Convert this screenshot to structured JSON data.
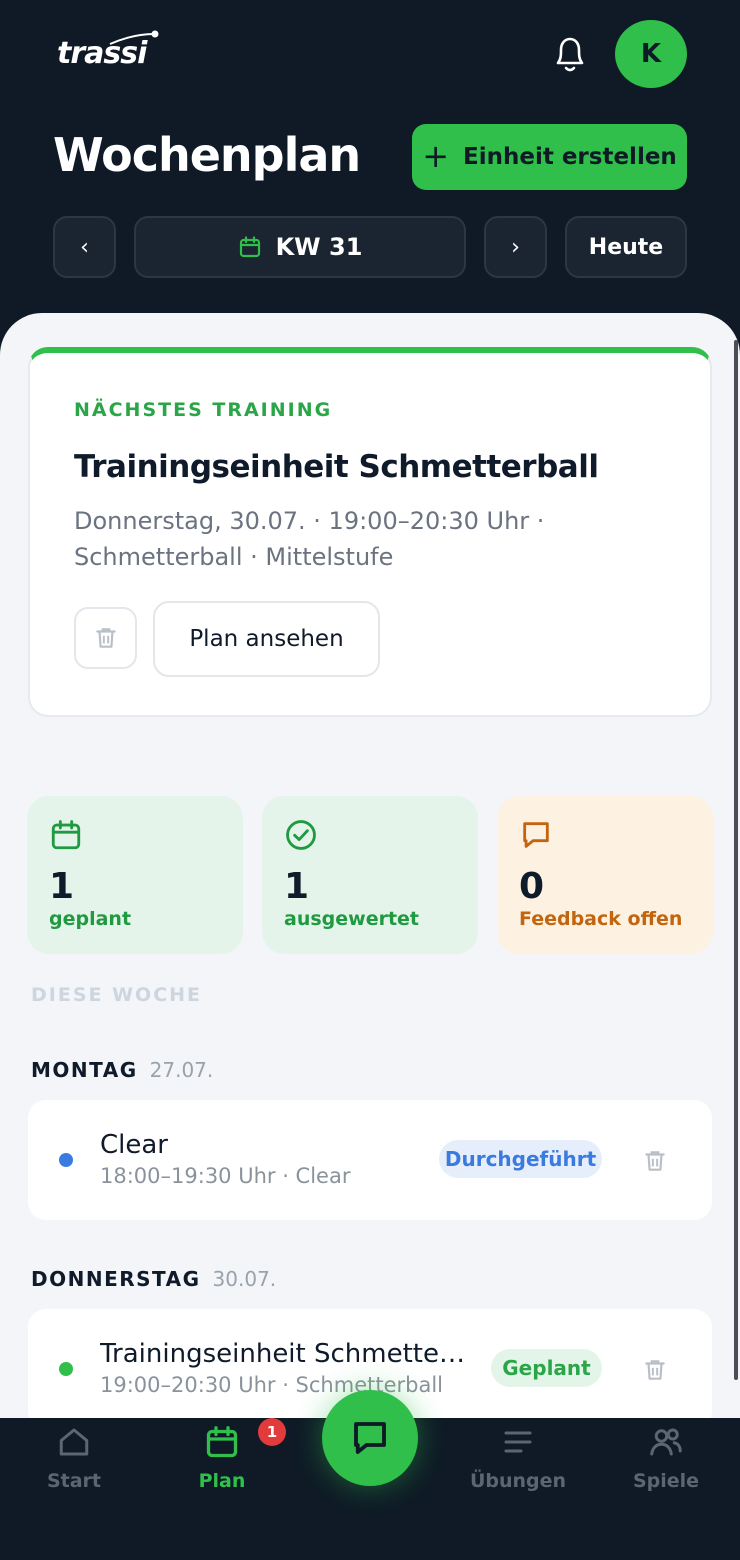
{
  "header": {
    "logo": "trassi",
    "avatar_initial": "K",
    "title": "Wochenplan",
    "create_button": "Einheit erstellen"
  },
  "week_nav": {
    "prev": "‹",
    "week_label": "KW 31",
    "next": "›",
    "today": "Heute"
  },
  "next_training": {
    "label": "NÄCHSTES TRAINING",
    "title": "Trainingseinheit Schmetterball",
    "meta": "Donnerstag, 30.07. · 19:00–20:30 Uhr · Schmetterball · Mittelstufe",
    "view_button": "Plan ansehen"
  },
  "stats": [
    {
      "value": "1",
      "label": "geplant",
      "icon": "calendar-icon"
    },
    {
      "value": "1",
      "label": "ausgewertet",
      "icon": "check-circle-icon"
    },
    {
      "value": "0",
      "label": "Feedback offen",
      "icon": "message-icon"
    }
  ],
  "week_section_label": "DIESE WOCHE",
  "days": [
    {
      "day": "MONTAG",
      "date": "27.07.",
      "events": [
        {
          "title": "Clear",
          "meta": "18:00–19:30 Uhr · Clear",
          "status": "Durchgeführt",
          "dot_color": "#3a7be0"
        }
      ]
    },
    {
      "day": "DONNERSTAG",
      "date": "30.07.",
      "events": [
        {
          "title": "Trainingseinheit Schmetterball",
          "meta": "19:00–20:30 Uhr · Schmetterball",
          "status": "Geplant",
          "dot_color": "#2fbf4a"
        }
      ]
    }
  ],
  "bottom_nav": {
    "tabs": [
      {
        "label": "Start",
        "icon": "home-icon"
      },
      {
        "label": "Plan",
        "icon": "calendar-icon",
        "badge": "1"
      },
      {
        "label": "Übungen",
        "icon": "list-icon"
      },
      {
        "label": "Spiele",
        "icon": "users-icon"
      }
    ]
  },
  "colors": {
    "accent": "#2fbf4a",
    "dark": "#0f1a26",
    "blue": "#3a7be0",
    "orange": "#c2650e",
    "badge_red": "#e23b3b"
  }
}
